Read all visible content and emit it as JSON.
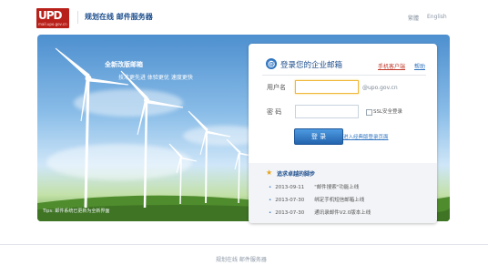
{
  "header": {
    "logo_text": "UPD",
    "logo_subtext": "mail.upo.gov.cn",
    "site_title": "规划在线 邮件服务器",
    "lang_zh": "繁體",
    "lang_en": "English"
  },
  "hero": {
    "headline": "全新改版邮箱",
    "slogan": "技术更先进 体验更优 速度更快",
    "caption": "Tips: 邮件系统已更新为全新界面"
  },
  "login": {
    "title": "登录您的企业邮箱",
    "client_link": "手机客户端",
    "help_link": "帮助",
    "username_label": "用户名",
    "password_label": "密  码",
    "username_value": "",
    "password_value": "",
    "domain_suffix": "@upo.gov.cn",
    "ssl_label": "SSL安全登录",
    "ssl_checked": false,
    "login_button": "登  录",
    "classic_link": "进入经典版登录页面"
  },
  "news": {
    "title": "追求卓越的脚步",
    "items": [
      {
        "date": "2013-09-11",
        "text": "\"邮件搜索\"功能上线"
      },
      {
        "date": "2013-07-30",
        "text": "绑定手机短信邮箱上线"
      },
      {
        "date": "2013-07-30",
        "text": "通讯录邮件V2.0版本上线"
      }
    ]
  },
  "footer": {
    "text": "规划在线 邮件服务器"
  },
  "colors": {
    "brand_red": "#b8201a",
    "primary_blue": "#2f74c0",
    "title_blue": "#1d4e8d"
  },
  "icons": {
    "at": "at-icon",
    "star": "star-icon"
  }
}
